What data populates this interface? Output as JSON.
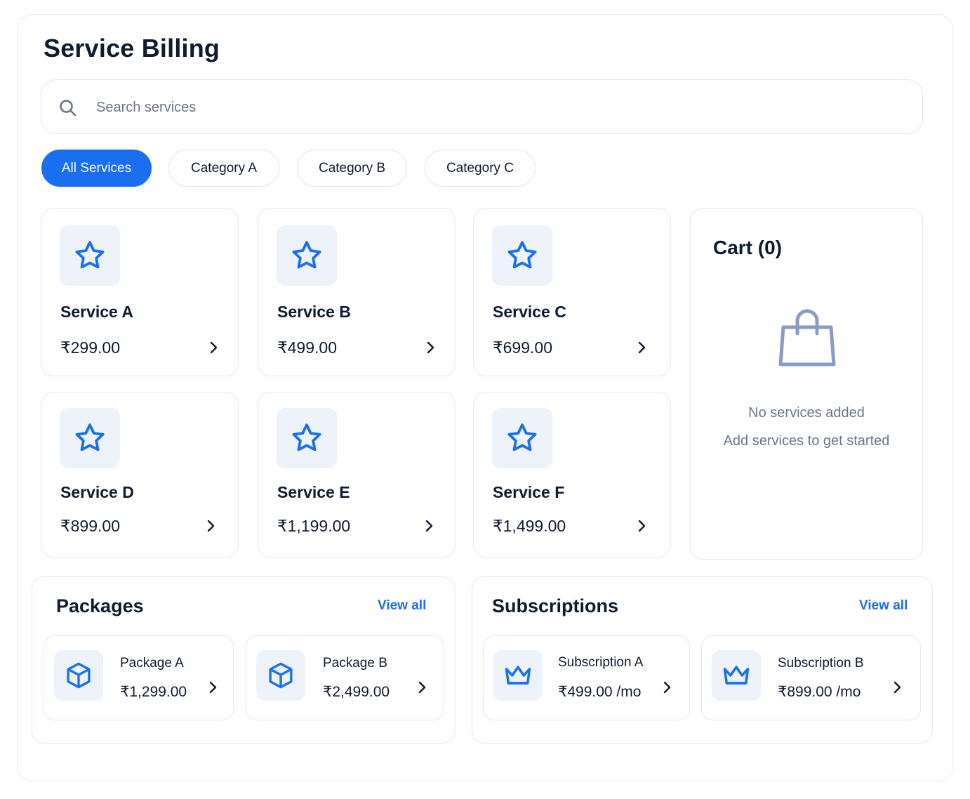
{
  "header": {
    "title": "Service Billing"
  },
  "search": {
    "placeholder": "Search services",
    "value": ""
  },
  "filters": [
    {
      "label": "All Services",
      "active": true
    },
    {
      "label": "Category A",
      "active": false
    },
    {
      "label": "Category B",
      "active": false
    },
    {
      "label": "Category C",
      "active": false
    }
  ],
  "services": [
    {
      "name": "Service A",
      "price": "₹299.00"
    },
    {
      "name": "Service B",
      "price": "₹499.00"
    },
    {
      "name": "Service C",
      "price": "₹699.00"
    },
    {
      "name": "Service D",
      "price": "₹899.00"
    },
    {
      "name": "Service E",
      "price": "₹1,199.00"
    },
    {
      "name": "Service F",
      "price": "₹1,499.00"
    }
  ],
  "cart": {
    "title": "Cart (0)",
    "empty_title": "No services added",
    "empty_subtitle": "Add services to get started"
  },
  "packages": {
    "title": "Packages",
    "view_all": "View all",
    "items": [
      {
        "name": "Package A",
        "price": "₹1,299.00"
      },
      {
        "name": "Package B",
        "price": "₹2,499.00"
      }
    ]
  },
  "subscriptions": {
    "title": "Subscriptions",
    "view_all": "View all",
    "items": [
      {
        "name": "Subscription A",
        "price": "₹499.00 /mo"
      },
      {
        "name": "Subscription B",
        "price": "₹899.00 /mo"
      }
    ]
  },
  "icons": {
    "search": "search-icon",
    "service": "star-icon",
    "cart": "shopping-bag-icon",
    "package": "cube-icon",
    "subscription": "crown-icon",
    "next": "chevron-right-icon"
  },
  "colors": {
    "accent": "#1a6ff0",
    "icon_tile": "#eef3fb",
    "muted_text": "#6b7689",
    "bag_stroke": "#8a9bc4"
  }
}
